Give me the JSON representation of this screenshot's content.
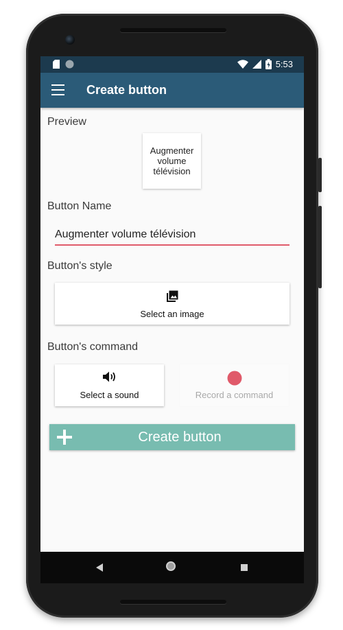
{
  "status_bar": {
    "time": "5:53",
    "icons": [
      "sd-card-icon",
      "circle-notification-icon",
      "wifi-icon",
      "signal-icon",
      "battery-charging-icon"
    ]
  },
  "app_bar": {
    "title": "Create button",
    "menu_icon": "hamburger-menu-icon"
  },
  "preview": {
    "label": "Preview",
    "button_text": "Augmenter volume télévision"
  },
  "button_name": {
    "label": "Button Name",
    "value": "Augmenter volume télévision"
  },
  "button_style": {
    "label": "Button's style",
    "select_image_label": "Select an image",
    "icon": "image-library-icon"
  },
  "button_command": {
    "label": "Button's command",
    "select_sound_label": "Select a sound",
    "sound_icon": "speaker-volume-icon",
    "record_label": "Record a command",
    "record_icon": "record-dot-icon"
  },
  "create_button": {
    "label": "Create button",
    "icon": "plus-icon"
  },
  "colors": {
    "status_bar": "#1c3a4e",
    "app_bar": "#2b5b78",
    "accent_underline": "#e05a6a",
    "record_dot": "#e05a6a",
    "create_button": "#78bcb0"
  },
  "nav_bar": {
    "icons": [
      "back-icon",
      "home-icon",
      "recents-icon"
    ]
  }
}
